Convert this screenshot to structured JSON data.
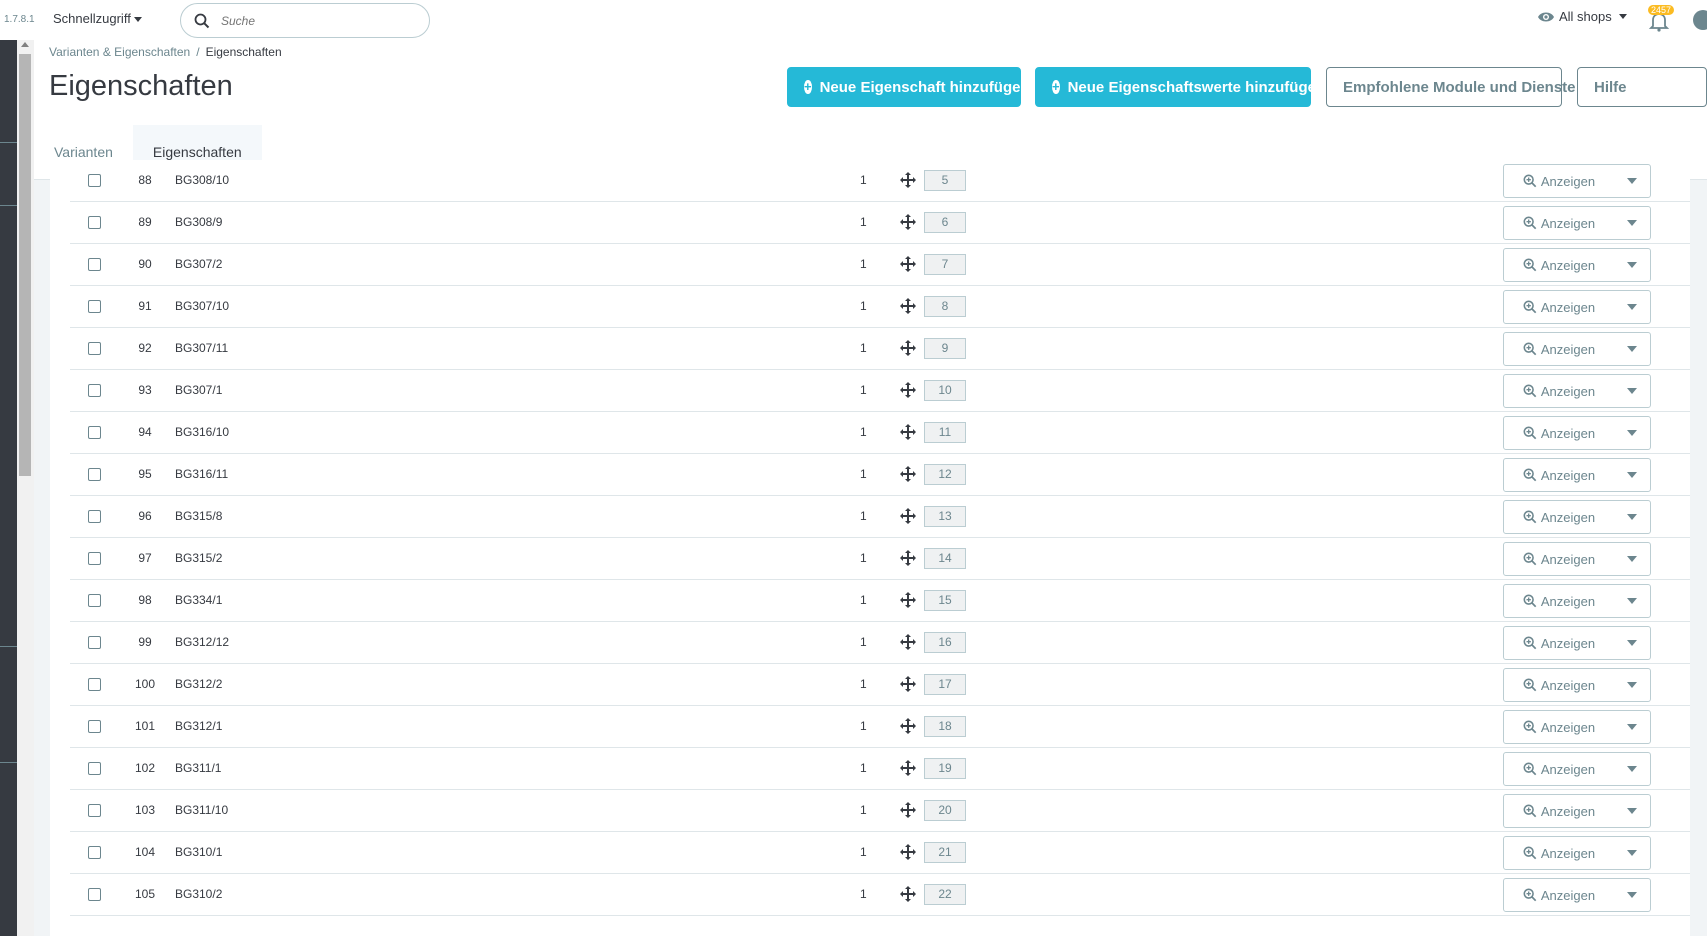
{
  "topbar": {
    "version": "1.7.8.1",
    "quick_access": "Schnellzugriff",
    "search_placeholder": "Suche",
    "shop_selector": "All shops",
    "notifications_count": "2457"
  },
  "breadcrumb": {
    "parent": "Varianten & Eigenschaften",
    "separator": "/",
    "current": "Eigenschaften"
  },
  "header": {
    "title": "Eigenschaften",
    "btn_add_feature": "Neue Eigenschaft hinzufügen",
    "btn_add_value": "Neue Eigenschaftswerte hinzufügen",
    "btn_modules": "Empfohlene Module und Dienste",
    "btn_help": "Hilfe"
  },
  "tabs": [
    {
      "label": "Varianten"
    },
    {
      "label": "Eigenschaften"
    }
  ],
  "view_label": "Anzeigen",
  "rows": [
    {
      "id": "88",
      "name": "BG308/10",
      "count": "1",
      "position": "5"
    },
    {
      "id": "89",
      "name": "BG308/9",
      "count": "1",
      "position": "6"
    },
    {
      "id": "90",
      "name": "BG307/2",
      "count": "1",
      "position": "7"
    },
    {
      "id": "91",
      "name": "BG307/10",
      "count": "1",
      "position": "8"
    },
    {
      "id": "92",
      "name": "BG307/11",
      "count": "1",
      "position": "9"
    },
    {
      "id": "93",
      "name": "BG307/1",
      "count": "1",
      "position": "10"
    },
    {
      "id": "94",
      "name": "BG316/10",
      "count": "1",
      "position": "11"
    },
    {
      "id": "95",
      "name": "BG316/11",
      "count": "1",
      "position": "12"
    },
    {
      "id": "96",
      "name": "BG315/8",
      "count": "1",
      "position": "13"
    },
    {
      "id": "97",
      "name": "BG315/2",
      "count": "1",
      "position": "14"
    },
    {
      "id": "98",
      "name": "BG334/1",
      "count": "1",
      "position": "15"
    },
    {
      "id": "99",
      "name": "BG312/12",
      "count": "1",
      "position": "16"
    },
    {
      "id": "100",
      "name": "BG312/2",
      "count": "1",
      "position": "17"
    },
    {
      "id": "101",
      "name": "BG312/1",
      "count": "1",
      "position": "18"
    },
    {
      "id": "102",
      "name": "BG311/1",
      "count": "1",
      "position": "19"
    },
    {
      "id": "103",
      "name": "BG311/10",
      "count": "1",
      "position": "20"
    },
    {
      "id": "104",
      "name": "BG310/1",
      "count": "1",
      "position": "21"
    },
    {
      "id": "105",
      "name": "BG310/2",
      "count": "1",
      "position": "22"
    }
  ],
  "colors": {
    "primary": "#25b9d7",
    "sidebar": "#363a41",
    "text": "#363a41",
    "muted": "#6c868e",
    "badge": "#fbbb22"
  }
}
